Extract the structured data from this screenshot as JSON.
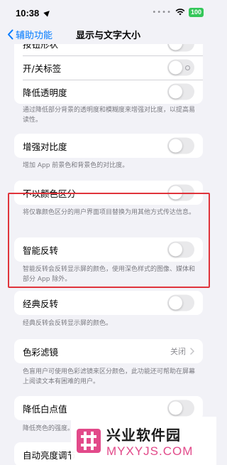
{
  "status_bar": {
    "time": "10:38",
    "battery": "100"
  },
  "nav": {
    "back_label": "辅助功能",
    "title": "显示与文字大小"
  },
  "rows": {
    "partial_top": "按钮形状",
    "onoff_labels": "开/关标签",
    "reduce_transparency": "降低透明度",
    "increase_contrast": "增强对比度",
    "differentiate_without_color": "不以颜色区分",
    "smart_invert": "智能反转",
    "classic_invert": "经典反转",
    "color_filters": "色彩滤镜",
    "color_filters_value": "关闭",
    "reduce_white_point": "降低白点值",
    "auto_brightness": "自动亮度调节"
  },
  "footers": {
    "reduce_transparency": "通过降低部分背景的透明度和模糊度来增强对比度，以提高易读性。",
    "increase_contrast": "增加 App 前景色和背景色的对比度。",
    "differentiate_without_color": "将仅靠颜色区分的用户界面项目替换为用其他方式传达信息。",
    "smart_invert": "智能反转会反转显示屏的颜色，使用深色样式的图像、媒体和部分 App 除外。",
    "classic_invert": "经典反转会反转显示屏的颜色。",
    "color_filters": "色盲用户可使用色彩滤镜来区分颜色，此功能还可帮助在屏幕上阅读文本有困难的用户。",
    "reduce_white_point": "降低亮色的强度。"
  },
  "toggles": {
    "partial_top": false,
    "onoff_labels": false,
    "reduce_transparency": false,
    "increase_contrast": false,
    "differentiate_without_color": false,
    "smart_invert": false,
    "classic_invert": false,
    "reduce_white_point": false
  },
  "watermark": {
    "cn": "兴业软件园",
    "en": "MYXYJS.COM"
  },
  "colors": {
    "accent": "#007aff",
    "highlight": "#e0343b",
    "watermark_en": "#e24a8a"
  }
}
